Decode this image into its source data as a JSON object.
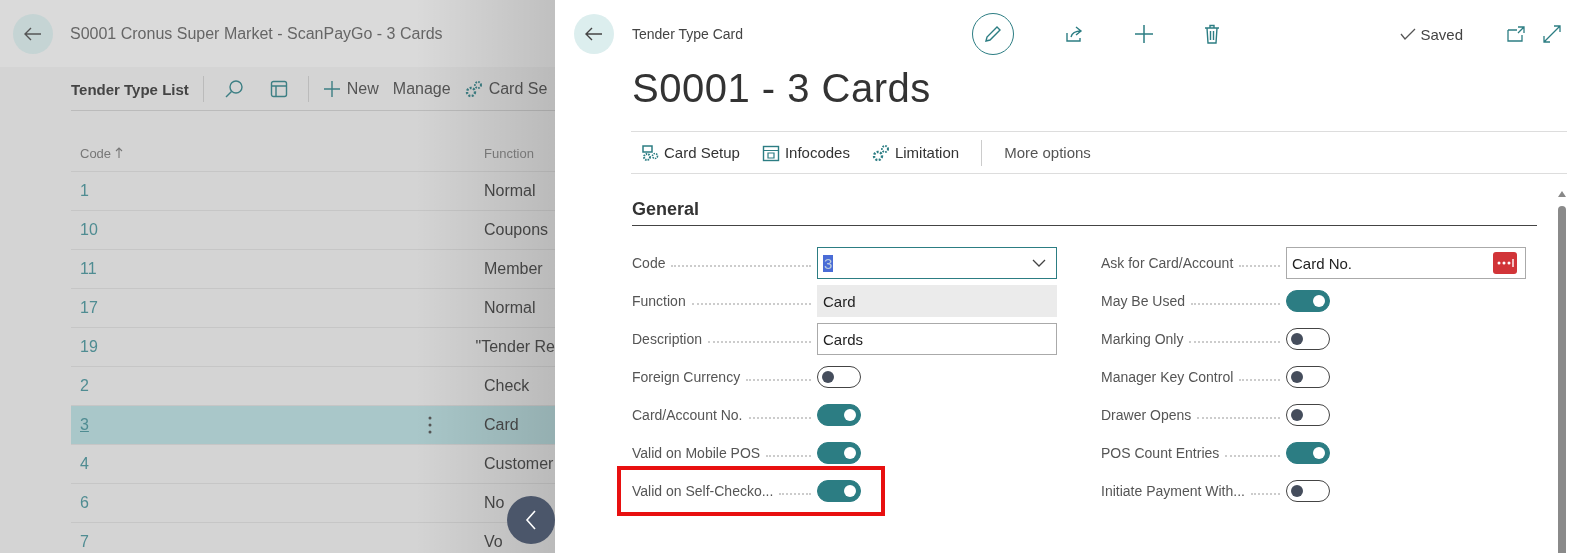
{
  "list_page": {
    "title": "S0001 Cronus Super Market - ScanPayGo - 3 Cards",
    "toolbar_title": "Tender Type List",
    "actions": [
      {
        "kind": "new",
        "label": "New"
      },
      {
        "kind": "plain",
        "label": "Manage"
      },
      {
        "kind": "gear",
        "label": "Card Se"
      }
    ],
    "columns": [
      "Code",
      "Function"
    ],
    "rows": [
      {
        "code": "1",
        "function": "Normal",
        "selected": false
      },
      {
        "code": "10",
        "function": "Coupons",
        "selected": false
      },
      {
        "code": "11",
        "function": "Member",
        "selected": false
      },
      {
        "code": "17",
        "function": "Normal",
        "selected": false
      },
      {
        "code": "19",
        "function": "\"Tender Re",
        "selected": false
      },
      {
        "code": "2",
        "function": "Check",
        "selected": false
      },
      {
        "code": "3",
        "function": "Card",
        "selected": true
      },
      {
        "code": "4",
        "function": "Customer",
        "selected": false
      },
      {
        "code": "6",
        "function": "No",
        "selected": false
      },
      {
        "code": "7",
        "function": "Vo",
        "selected": false
      }
    ]
  },
  "card": {
    "breadcrumb": "Tender Type Card",
    "title": "S0001 - 3 Cards",
    "status": "Saved",
    "actions": [
      {
        "kind": "card-setup",
        "label": "Card Setup"
      },
      {
        "kind": "calendar",
        "label": "Infocodes"
      },
      {
        "kind": "gear",
        "label": "Limitation"
      },
      {
        "kind": "more",
        "label": "More options"
      }
    ],
    "section": "General",
    "left_fields": [
      {
        "label": "Code",
        "kind": "dropdown",
        "value": "3",
        "highlighted": false
      },
      {
        "label": "Function",
        "kind": "readonly",
        "value": "Card",
        "highlighted": false
      },
      {
        "label": "Description",
        "kind": "text",
        "value": "Cards",
        "highlighted": false
      },
      {
        "label": "Foreign Currency",
        "kind": "toggle",
        "on": false,
        "highlighted": false
      },
      {
        "label": "Card/Account No.",
        "kind": "toggle",
        "on": true,
        "highlighted": false
      },
      {
        "label": "Valid on Mobile POS",
        "kind": "toggle",
        "on": true,
        "highlighted": false
      },
      {
        "label": "Valid on Self-Checko...",
        "kind": "toggle",
        "on": true,
        "highlighted": true
      }
    ],
    "right_fields": [
      {
        "label": "Ask for Card/Account",
        "kind": "lookup",
        "value": "Card No.",
        "highlighted": false
      },
      {
        "label": "May Be Used",
        "kind": "toggle",
        "on": true,
        "highlighted": false
      },
      {
        "label": "Marking Only",
        "kind": "toggle",
        "on": false,
        "highlighted": false
      },
      {
        "label": "Manager Key Control",
        "kind": "toggle",
        "on": false,
        "highlighted": false
      },
      {
        "label": "Drawer Opens",
        "kind": "toggle",
        "on": false,
        "highlighted": false
      },
      {
        "label": "POS Count Entries",
        "kind": "toggle",
        "on": true,
        "highlighted": false
      },
      {
        "label": "Initiate Payment With...",
        "kind": "toggle",
        "on": false,
        "highlighted": false
      }
    ]
  }
}
